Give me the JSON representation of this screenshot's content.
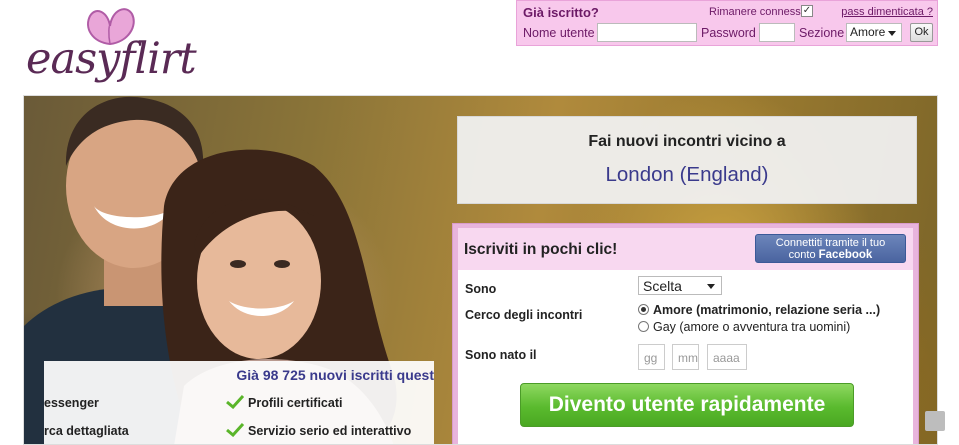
{
  "brand": {
    "logo_text": "easyflirt"
  },
  "login": {
    "title": "Già iscritto?",
    "remember_label": "Rimanere connessi",
    "remember_checked": true,
    "forgot_link": "pass dimenticata ?",
    "username_label": "Nome utente",
    "username_value": "",
    "password_label": "Password",
    "password_value": "",
    "section_label": "Sezione",
    "section_selected": "Amore",
    "ok_label": "Ok"
  },
  "location": {
    "line1": "Fai nuovi incontri vicino a",
    "place": "London (England)"
  },
  "stats": {
    "headline": "Già 98 725 nuovi iscritti quest",
    "items": [
      {
        "label": "essenger"
      },
      {
        "label": "Profili certificati"
      },
      {
        "label": "rca dettagliata"
      },
      {
        "label": "Servizio serio ed interattivo"
      }
    ]
  },
  "signup": {
    "title": "Iscriviti in pochi clic!",
    "facebook_line1": "Connettiti tramite il tuo",
    "facebook_line2_prefix": "conto ",
    "facebook_line2_brand": "Facebook",
    "sono_label": "Sono",
    "sono_selected": "Scelta",
    "cerco_label": "Cerco degli incontri",
    "option_amore": "Amore (matrimonio, relazione seria ...)",
    "option_gay": "Gay (amore o avventura tra uomini)",
    "selected_option": "amore",
    "born_label": "Sono nato il",
    "day_placeholder": "gg",
    "month_placeholder": "mm",
    "year_placeholder": "aaaa",
    "submit_label": "Divento utente rapidamente"
  },
  "colors": {
    "login_bg": "#f8c8ec",
    "brand_purple": "#6c1a66",
    "accent_blue": "#3a3a8c",
    "cta_green": "#5aba2e",
    "facebook_blue": "#4a64a0"
  },
  "icons": [
    "butterfly-logo-icon",
    "checkmark-icon",
    "expand-icon"
  ]
}
